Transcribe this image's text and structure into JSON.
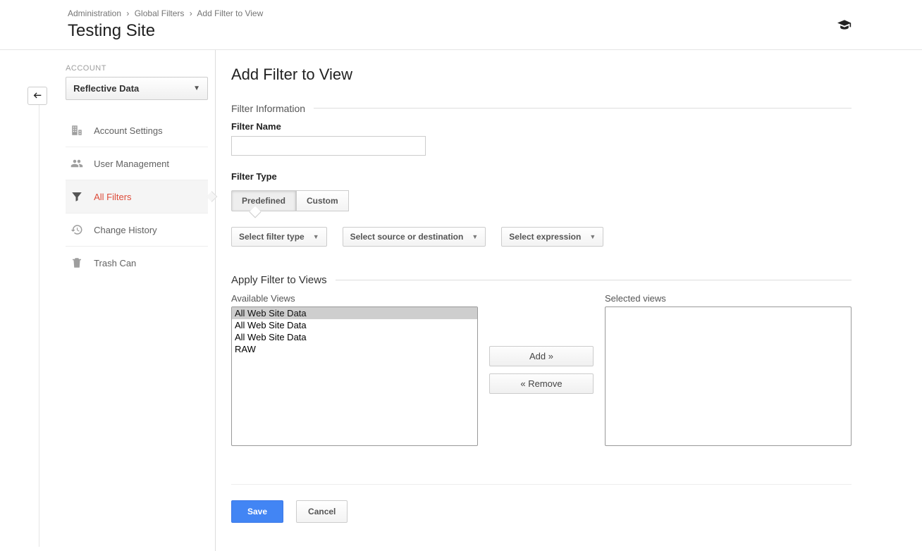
{
  "breadcrumb": {
    "a": "Administration",
    "b": "Global Filters",
    "c": "Add Filter to View"
  },
  "site_title": "Testing Site",
  "sidebar": {
    "section_label": "ACCOUNT",
    "account_name": "Reflective Data",
    "items": [
      {
        "label": "Account Settings",
        "icon": "building"
      },
      {
        "label": "User Management",
        "icon": "users"
      },
      {
        "label": "All Filters",
        "icon": "filter",
        "active": true
      },
      {
        "label": "Change History",
        "icon": "history"
      },
      {
        "label": "Trash Can",
        "icon": "trash"
      }
    ]
  },
  "main": {
    "title": "Add Filter to View",
    "filter_info_heading": "Filter Information",
    "filter_name_label": "Filter Name",
    "filter_name_value": "",
    "filter_type_label": "Filter Type",
    "toggle": {
      "predefined": "Predefined",
      "custom": "Custom"
    },
    "dropdowns": {
      "filter_type": "Select filter type",
      "source": "Select source or destination",
      "expression": "Select expression"
    },
    "apply_heading": "Apply Filter to Views",
    "available_label": "Available Views",
    "selected_label": "Selected views",
    "available_views": [
      "All Web Site Data",
      "All Web Site Data",
      "All Web Site Data",
      "RAW"
    ],
    "selected_views": [],
    "add_btn": "Add »",
    "remove_btn": "« Remove",
    "save_btn": "Save",
    "cancel_btn": "Cancel"
  }
}
